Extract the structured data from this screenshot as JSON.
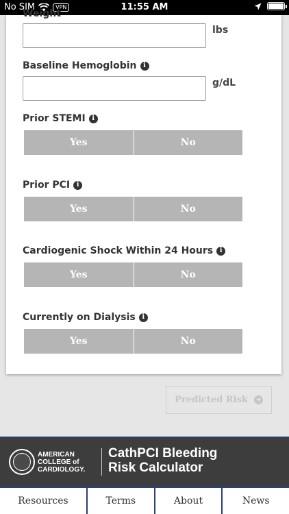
{
  "status_bar": {
    "carrier": "No SIM",
    "vpn": "VPN",
    "time": "11:55 AM",
    "battery_level": 1.0
  },
  "form": {
    "weight": {
      "label": "Weight",
      "value": "",
      "unit": "lbs"
    },
    "baseline_hemoglobin": {
      "label": "Baseline Hemoglobin",
      "value": "",
      "unit": "g/dL"
    },
    "prior_stemi": {
      "label": "Prior STEMI",
      "yes": "Yes",
      "no": "No"
    },
    "prior_pci": {
      "label": "Prior PCI",
      "yes": "Yes",
      "no": "No"
    },
    "cardiogenic_shock": {
      "label": "Cardiogenic Shock Within 24 Hours",
      "yes": "Yes",
      "no": "No"
    },
    "dialysis": {
      "label": "Currently on Dialysis",
      "yes": "Yes",
      "no": "No"
    },
    "info_glyph": "i"
  },
  "predicted_risk_label": "Predicted Risk",
  "banner": {
    "org_line1": "AMERICAN",
    "org_line2": "COLLEGE of",
    "org_line3": "CARDIOLOGY.",
    "title_line1": "CathPCI Bleeding",
    "title_line2": "Risk Calculator"
  },
  "tabs": [
    "Resources",
    "Terms",
    "About",
    "News"
  ],
  "colors": {
    "toggle_bg": "#b5b5b5",
    "banner_bg": "#3d3d3d",
    "tabbar_accent": "#2b3f70",
    "page_bg": "#e6e6e6"
  }
}
